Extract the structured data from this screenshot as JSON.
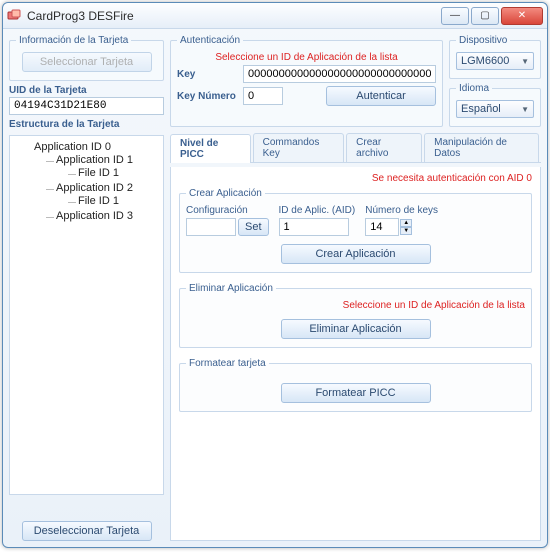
{
  "window": {
    "title": "CardProg3 DESFire"
  },
  "winbtns": {
    "min": "—",
    "max": "▢",
    "close": "✕"
  },
  "left": {
    "info_legend": "Información de la Tarjeta",
    "select_btn": "Seleccionar Tarjeta",
    "uid_label": "UID de la Tarjeta",
    "uid_value": "04194C31D21E80",
    "struct_legend": "Estructura de la Tarjeta",
    "tree": {
      "app0": "Application ID 0",
      "app1": "Application ID 1",
      "file1a": "File ID 1",
      "app2": "Application ID 2",
      "file1b": "File ID 1",
      "app3": "Application ID 3"
    },
    "deselect_btn": "Deseleccionar Tarjeta"
  },
  "auth": {
    "legend": "Autenticación",
    "warn": "Seleccione un ID de Aplicación de la lista",
    "key_label": "Key",
    "key_value": "00000000000000000000000000000000",
    "keynum_label": "Key Número",
    "keynum_value": "0",
    "auth_btn": "Autenticar"
  },
  "device": {
    "legend": "Dispositivo",
    "value": "LGM6600",
    "lang_legend": "Idioma",
    "lang_value": "Español"
  },
  "tabs": {
    "t0": "Nivel de PICC",
    "t1": "Commandos Key",
    "t2": "Crear archivo",
    "t3": "Manipulación de Datos"
  },
  "picc": {
    "warn": "Se necesita autenticación con AID 0",
    "create_legend": "Crear Aplicación",
    "config_label": "Configuración",
    "config_value": "",
    "set_btn": "Set",
    "aid_label": "ID de Aplic. (AID)",
    "aid_value": "1",
    "numkeys_label": "Número de keys",
    "numkeys_value": "14",
    "create_btn": "Crear Aplicación",
    "delete_legend": "Eliminar Aplicación",
    "delete_warn": "Seleccione un ID de Aplicación de la lista",
    "delete_btn": "Eliminar Aplicación",
    "format_legend": "Formatear tarjeta",
    "format_btn": "Formatear PICC"
  }
}
